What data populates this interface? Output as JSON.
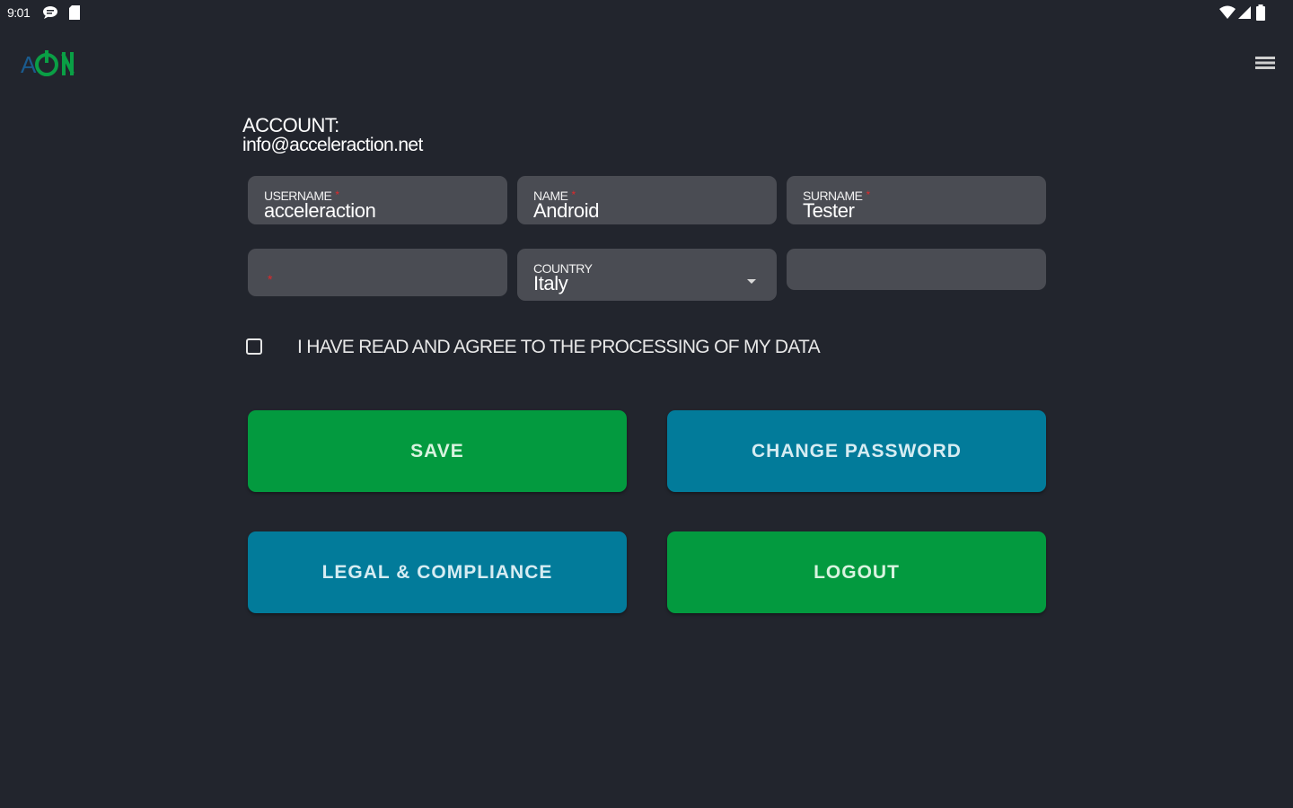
{
  "status_bar": {
    "time": "9:01",
    "icons": [
      "chat-bubble-icon",
      "sd-card-icon",
      "wifi-icon",
      "cell-signal-icon",
      "battery-icon"
    ]
  },
  "app": {
    "logo_icon": "acceleraction-power-logo",
    "menu_icon": "hamburger-menu-icon"
  },
  "account": {
    "label": "ACCOUNT:",
    "email": "info@acceleraction.net"
  },
  "form": {
    "username": {
      "label": "USERNAME",
      "value": "acceleraction",
      "required": true
    },
    "name": {
      "label": "NAME",
      "value": "Android",
      "required": true
    },
    "surname": {
      "label": "SURNAME",
      "value": "Tester",
      "required": true
    },
    "field_4": {
      "label": "",
      "value": "",
      "required": true
    },
    "country": {
      "label": "COUNTRY",
      "value": "Italy",
      "required": false
    },
    "field_6": {
      "label": "",
      "value": "",
      "required": false
    },
    "required_marker": "*"
  },
  "consent": {
    "checked": false,
    "text": "I HAVE READ AND AGREE TO THE PROCESSING OF MY DATA"
  },
  "buttons": {
    "save": "SAVE",
    "change_password": "CHANGE PASSWORD",
    "legal": "LEGAL & COMPLIANCE",
    "logout": "LOGOUT"
  },
  "colors": {
    "background": "#22252d",
    "field": "#4a4c53",
    "green": "#039a3f",
    "blue": "#027b9a",
    "required": "#e0282a"
  }
}
